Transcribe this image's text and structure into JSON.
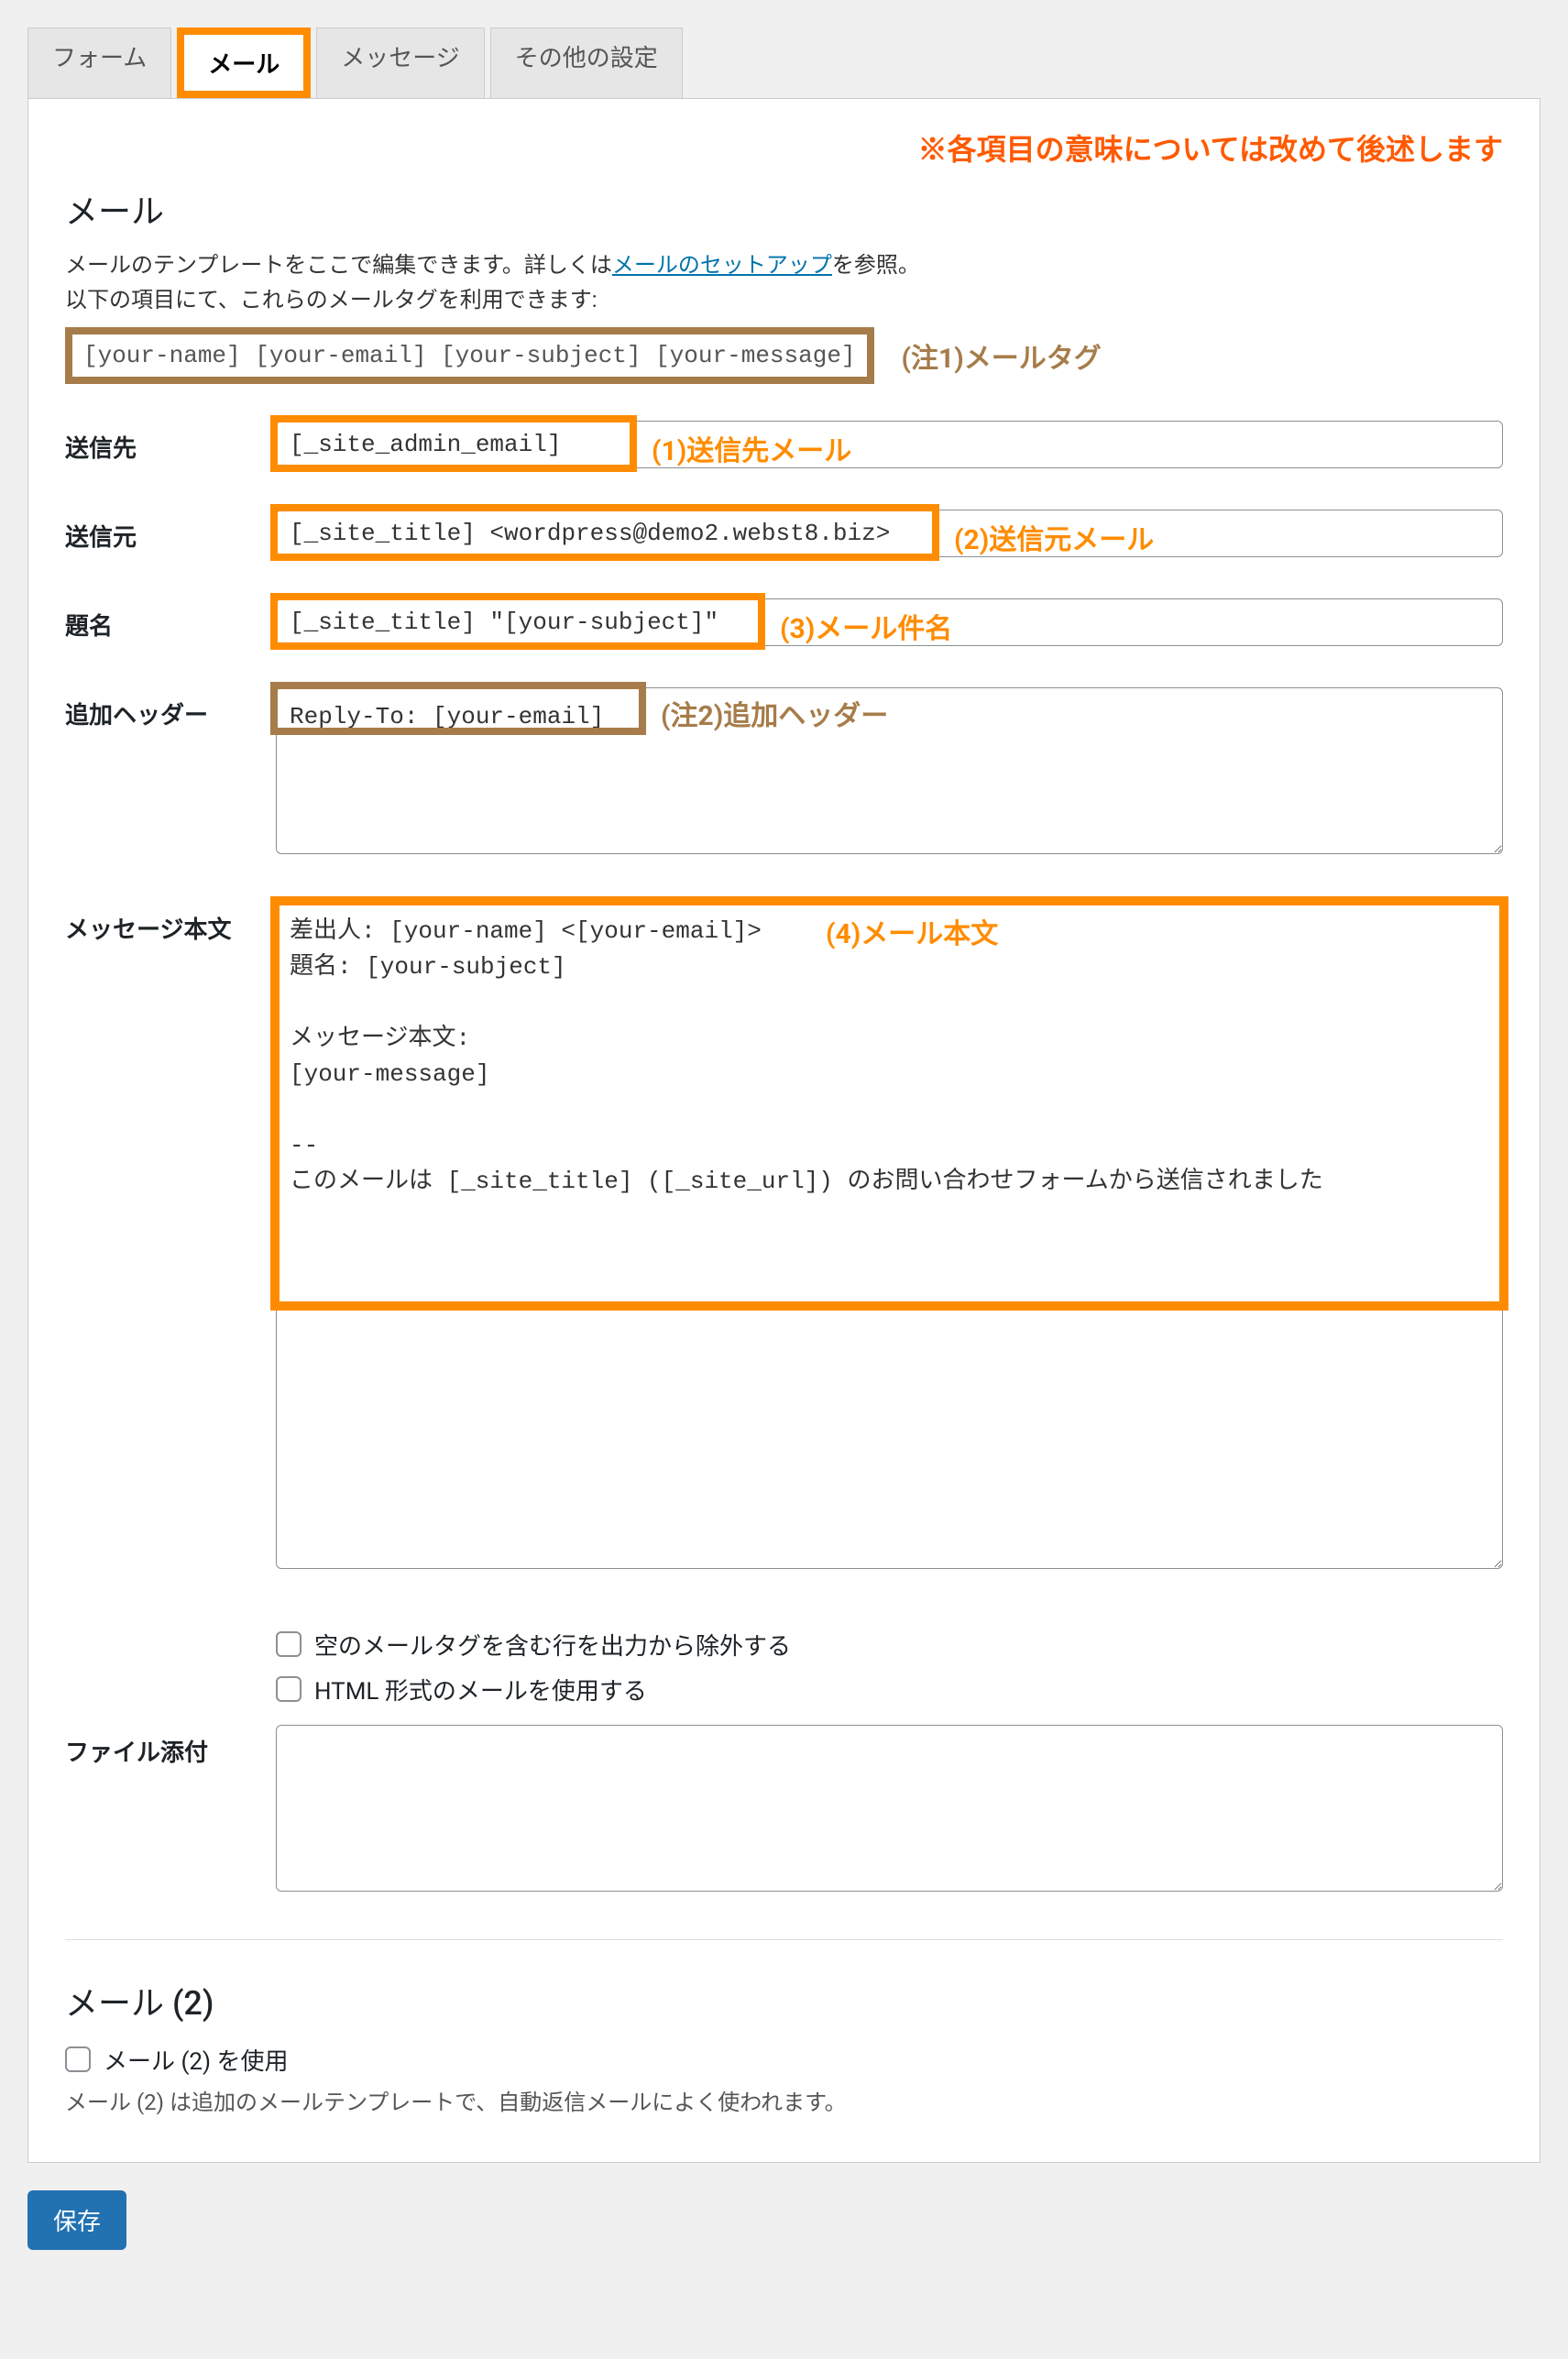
{
  "tabs": {
    "form": "フォーム",
    "mail": "メール",
    "messages": "メッセージ",
    "other": "その他の設定"
  },
  "topNote": "※各項目の意味については改めて後述します",
  "section": {
    "title": "メール",
    "desc1_pre": "メールのテンプレートをここで編集できます。詳しくは",
    "desc1_link": "メールのセットアップ",
    "desc1_post": "を参照。",
    "desc2": "以下の項目にて、これらのメールタグを利用できます:",
    "mailTags": "[your-name] [your-email] [your-subject] [your-message]",
    "mailTagsAnnot": "(注1)メールタグ"
  },
  "fields": {
    "to": {
      "label": "送信先",
      "value": "[_site_admin_email]",
      "annot": "(1)送信先メール"
    },
    "from": {
      "label": "送信元",
      "value": "[_site_title] <wordpress@demo2.webst8.biz>",
      "annot": "(2)送信元メール"
    },
    "subject": {
      "label": "題名",
      "value": "[_site_title] \"[your-subject]\"",
      "annot": "(3)メール件名"
    },
    "headers": {
      "label": "追加ヘッダー",
      "value": "Reply-To: [your-email]",
      "annot": "(注2)追加ヘッダー"
    },
    "body": {
      "label": "メッセージ本文",
      "value": "差出人: [your-name] <[your-email]>\n題名: [your-subject]\n\nメッセージ本文:\n[your-message]\n\n-- \nこのメールは [_site_title] ([_site_url]) のお問い合わせフォームから送信されました",
      "annot": "(4)メール本文"
    },
    "excludeBlank": "空のメールタグを含む行を出力から除外する",
    "useHtml": "HTML 形式のメールを使用する",
    "attachments": {
      "label": "ファイル添付",
      "value": ""
    }
  },
  "mail2": {
    "title": "メール (2)",
    "checkbox": "メール (2) を使用",
    "note": "メール (2) は追加のメールテンプレートで、自動返信メールによく使われます。"
  },
  "saveButton": "保存"
}
